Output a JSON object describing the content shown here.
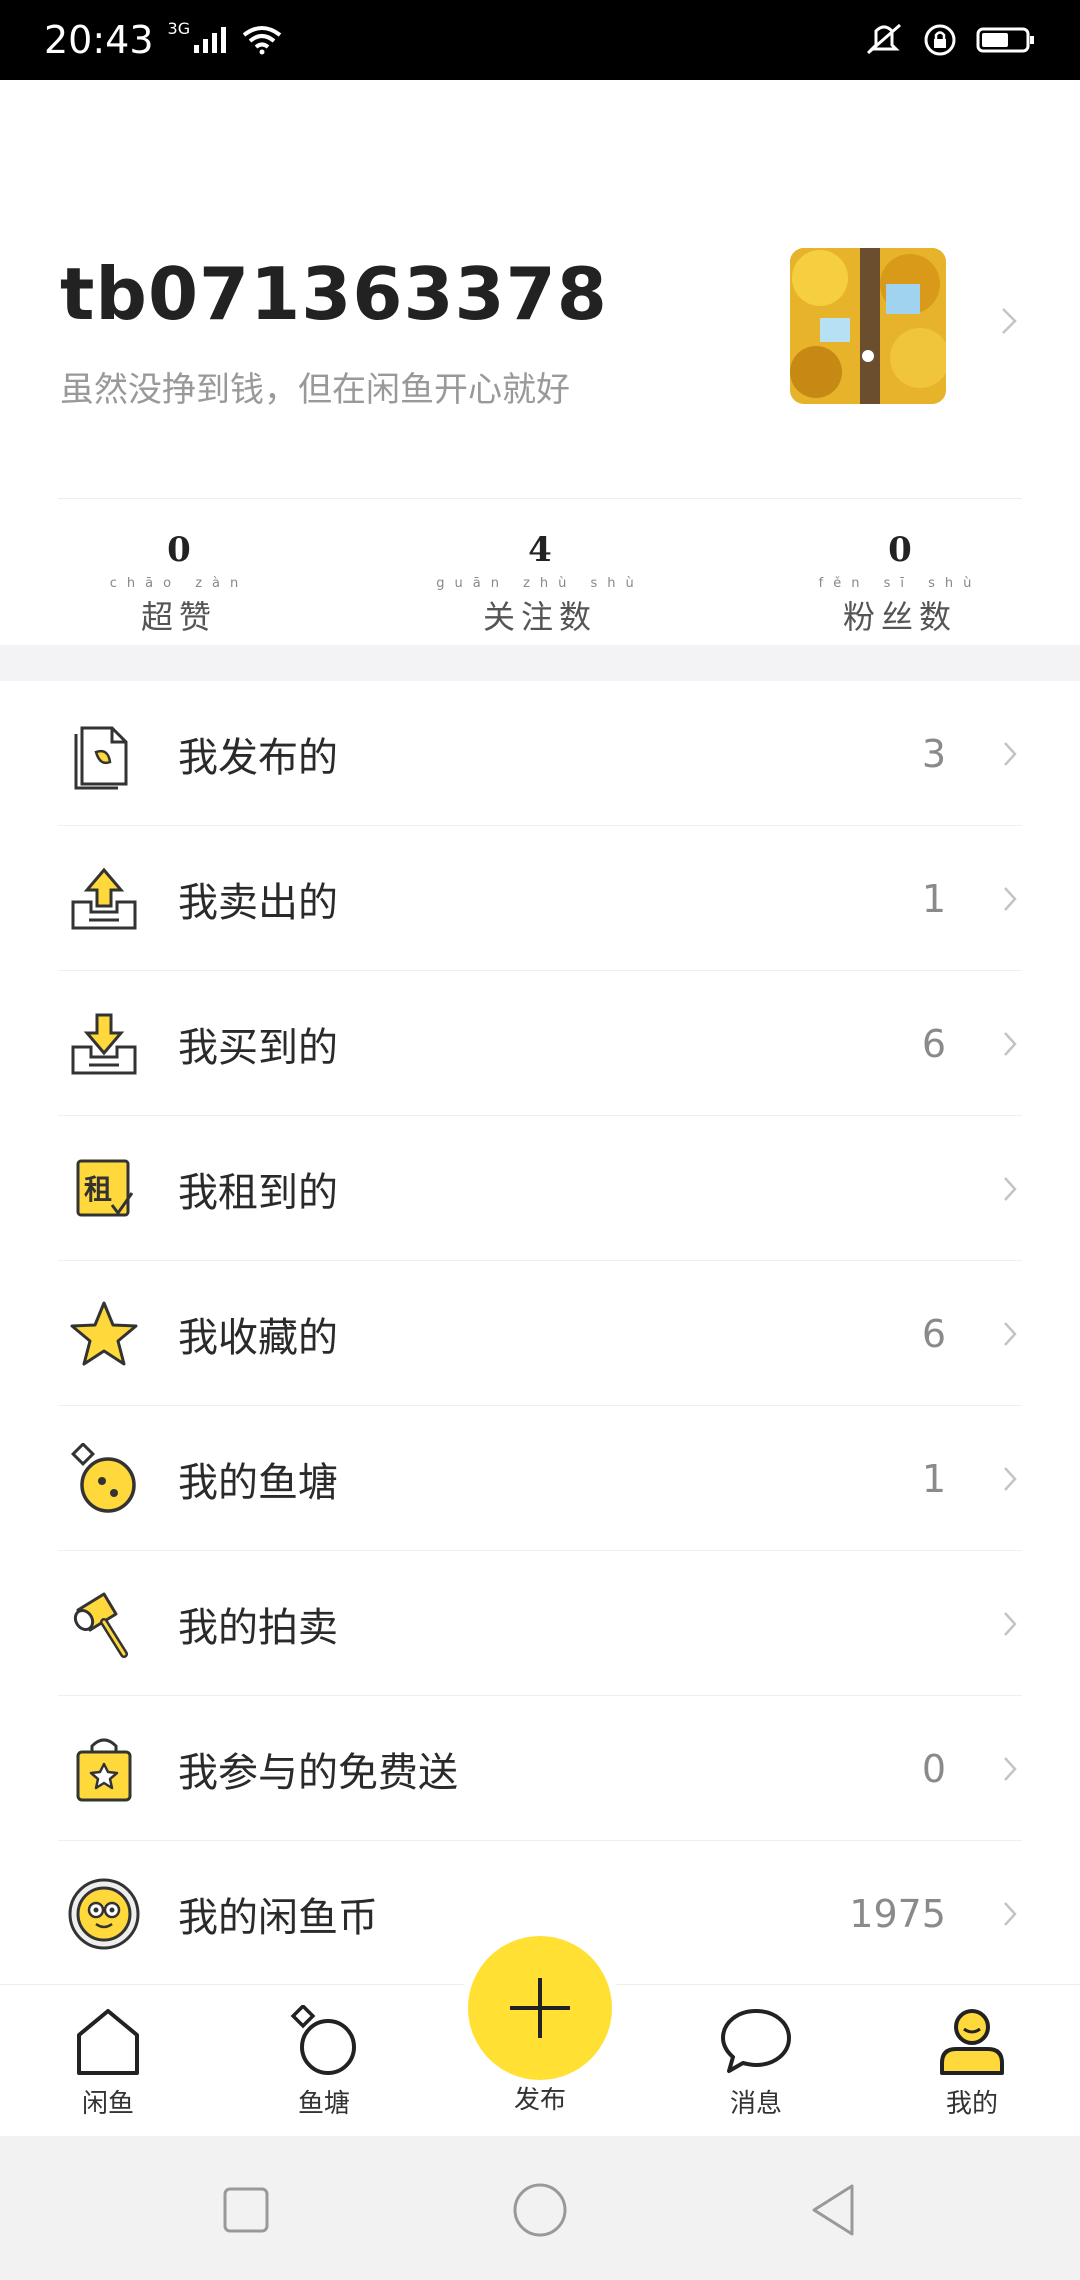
{
  "status_bar": {
    "time": "20:43",
    "network": "3G"
  },
  "profile": {
    "username": "tb071363378",
    "bio": "虽然没挣到钱，但在闲鱼开心就好"
  },
  "stats": [
    {
      "value": "0",
      "label": "超赞",
      "pinyin": "chāo zàn"
    },
    {
      "value": "4",
      "label": "关注数",
      "pinyin": "guān zhù shù"
    },
    {
      "value": "0",
      "label": "粉丝数",
      "pinyin": "fěn sī shù"
    }
  ],
  "menu": [
    {
      "label": "我发布的",
      "count": "3",
      "icon": "document-icon"
    },
    {
      "label": "我卖出的",
      "count": "1",
      "icon": "upload-tray-icon"
    },
    {
      "label": "我买到的",
      "count": "6",
      "icon": "download-tray-icon"
    },
    {
      "label": "我租到的",
      "count": "",
      "icon": "rent-icon",
      "icon_text": "租"
    },
    {
      "label": "我收藏的",
      "count": "6",
      "icon": "star-icon"
    },
    {
      "label": "我的鱼塘",
      "count": "1",
      "icon": "pond-icon"
    },
    {
      "label": "我的拍卖",
      "count": "",
      "icon": "auction-hammer-icon"
    },
    {
      "label": "我参与的免费送",
      "count": "0",
      "icon": "gift-bag-icon"
    },
    {
      "label": "我的闲鱼币",
      "count": "1975",
      "icon": "coin-icon"
    }
  ],
  "tabs": [
    {
      "label": "闲鱼",
      "icon": "home-icon"
    },
    {
      "label": "鱼塘",
      "icon": "pond-icon"
    },
    {
      "label": "发布",
      "icon": "plus-icon"
    },
    {
      "label": "消息",
      "icon": "message-icon"
    },
    {
      "label": "我的",
      "icon": "profile-icon"
    }
  ],
  "colors": {
    "accent": "#ffe033",
    "icon_yellow": "#ffd93b",
    "text_gray": "#999999"
  }
}
